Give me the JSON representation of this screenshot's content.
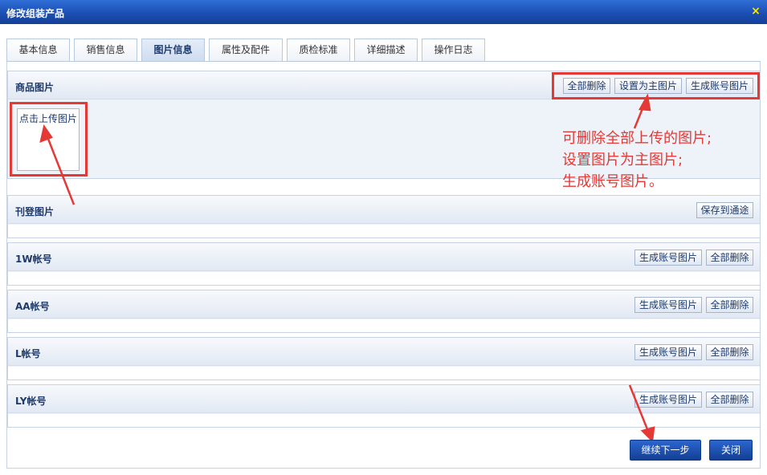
{
  "window": {
    "title": "修改组装产品",
    "close_icon": "×"
  },
  "tabs": [
    {
      "label": "基本信息"
    },
    {
      "label": "销售信息"
    },
    {
      "label": "图片信息",
      "active": true
    },
    {
      "label": "属性及配件"
    },
    {
      "label": "质检标准"
    },
    {
      "label": "详细描述"
    },
    {
      "label": "操作日志"
    }
  ],
  "product_images": {
    "label": "商品图片",
    "buttons": {
      "delete_all": "全部删除",
      "set_main": "设置为主图片",
      "generate_account": "生成账号图片"
    },
    "upload_label": "点击上传图片"
  },
  "annotation": {
    "lines": [
      "可删除全部上传的图片;",
      "设置图片为主图片;",
      "生成账号图片。"
    ],
    "color": "#e53935"
  },
  "listing_images": {
    "label": "刊登图片",
    "button": "保存到通途"
  },
  "accounts": [
    {
      "label": "1W帐号",
      "generate": "生成账号图片",
      "delete_all": "全部删除"
    },
    {
      "label": "AA帐号",
      "generate": "生成账号图片",
      "delete_all": "全部删除"
    },
    {
      "label": "L帐号",
      "generate": "生成账号图片",
      "delete_all": "全部删除"
    },
    {
      "label": "LY帐号",
      "generate": "生成账号图片",
      "delete_all": "全部删除"
    }
  ],
  "footer": {
    "next": "继续下一步",
    "close": "关闭"
  },
  "colors": {
    "titlebar": "#1b4fb3",
    "accent": "#1e3a6b",
    "highlight": "#e53935"
  }
}
